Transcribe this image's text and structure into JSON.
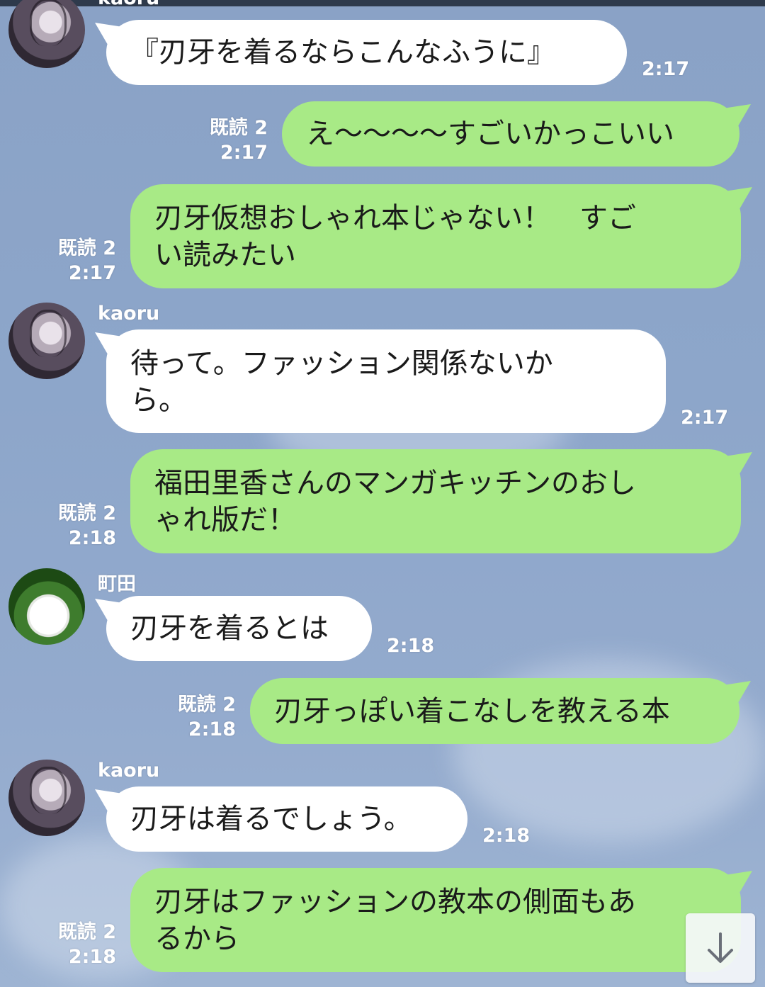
{
  "chat": {
    "messages": [
      {
        "sender": "kaoru",
        "text": "『刃牙を着るならこんなふうに』",
        "time": "2:17"
      },
      {
        "read": "既読 2",
        "text": "え～～～～すごいかっこいい",
        "time": "2:17"
      },
      {
        "read": "既読 2",
        "text": "刃牙仮想おしゃれ本じゃない！　すご\nい読みたい",
        "time": "2:17"
      },
      {
        "sender": "kaoru",
        "text": "待って。ファッション関係ないか\nら。",
        "time": "2:17"
      },
      {
        "read": "既読 2",
        "text": "福田里香さんのマンガキッチンのおし\nゃれ版だ！",
        "time": "2:18"
      },
      {
        "sender": "町田",
        "text": "刃牙を着るとは",
        "time": "2:18"
      },
      {
        "read": "既読 2",
        "text": "刃牙っぽい着こなしを教える本",
        "time": "2:18"
      },
      {
        "sender": "kaoru",
        "text": "刃牙は着るでしょう。",
        "time": "2:18"
      },
      {
        "read": "既読 2",
        "text": "刃牙はファッションの教本の側面もあ\nるから",
        "time": "2:18"
      }
    ]
  },
  "icons": {
    "scroll_down": "arrow-down-icon"
  },
  "colors": {
    "background": "#8da6ca",
    "incoming_bubble": "#ffffff",
    "outgoing_bubble": "#a8ea86",
    "meta_text": "#ffffff"
  }
}
